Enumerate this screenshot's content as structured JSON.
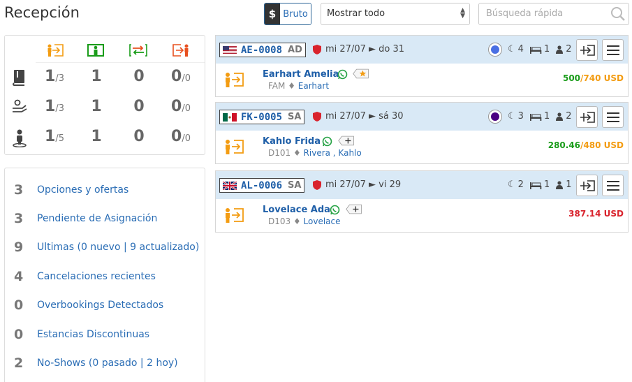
{
  "header": {
    "title": "Recepción",
    "currency_symbol": "$",
    "gross_label": "Bruto",
    "filter_value": "Mostrar todo",
    "search_placeholder": "Búsqueda rápida"
  },
  "summary": {
    "columns": [
      "arrivals-icon",
      "in-house-icon",
      "room-moves-icon",
      "departures-icon"
    ],
    "column_colors": [
      "#f39c12",
      "#1a9c1a",
      "#1a9c1a",
      "#e8501f"
    ],
    "rows": [
      {
        "icon": "book-icon",
        "arrivals": "1",
        "arrivals_total": "/3",
        "in_house": "1",
        "moves": "0",
        "departures": "0",
        "departures_total": "/0"
      },
      {
        "icon": "service-icon",
        "arrivals": "1",
        "arrivals_total": "/3",
        "in_house": "1",
        "moves": "0",
        "departures": "0",
        "departures_total": "/0"
      },
      {
        "icon": "person-icon",
        "arrivals": "1",
        "arrivals_total": "/5",
        "in_house": "1",
        "moves": "0",
        "departures": "0",
        "departures_total": "/0"
      }
    ]
  },
  "lists": [
    {
      "count": "3",
      "label": "Opciones y ofertas"
    },
    {
      "count": "3",
      "label": "Pendiente de Asignación"
    },
    {
      "count": "9",
      "label": "Ultimas (0 nuevo | 9 actualizado)"
    },
    {
      "count": "4",
      "label": "Cancelaciones recientes"
    },
    {
      "count": "0",
      "label": "Overbookings Detectados"
    },
    {
      "count": "0",
      "label": "Estancias Discontinuas"
    },
    {
      "count": "2",
      "label": "No-Shows (0 pasado | 2 hoy)"
    }
  ],
  "reservations": [
    {
      "flag": "us-flag-icon",
      "code": "AE-0008",
      "type": "AD",
      "dates": "mi 27/07 ► do 31",
      "status_color": "#4a6fe3",
      "nights": "4",
      "rooms": "1",
      "guests": "2",
      "guest_name": "Earhart Amelia",
      "room": "FAM",
      "sub_name": "Earhart",
      "tag": "star-tag-icon",
      "paid": "500",
      "total": "/740 USD",
      "paid_color": "#1a9c1a",
      "total_color": "#f39c12"
    },
    {
      "flag": "mx-flag-icon",
      "code": "FK-0005",
      "type": "SA",
      "dates": "mi 27/07 ► sá 30",
      "status_color": "#4b0082",
      "nights": "3",
      "rooms": "1",
      "guests": "2",
      "guest_name": "Kahlo Frida",
      "room": "D101",
      "sub_name": "Rivera , Kahlo",
      "tag": "plus-tag-icon",
      "paid": "280.46",
      "total": "/480 USD",
      "paid_color": "#1a9c1a",
      "total_color": "#f39c12"
    },
    {
      "flag": "uk-flag-icon",
      "code": "AL-0006",
      "type": "SA",
      "dates": "mi 27/07 ► vi 29",
      "status_color": "",
      "nights": "2",
      "rooms": "1",
      "guests": "1",
      "guest_name": "Lovelace Ada",
      "room": "D103",
      "sub_name": "Lovelace",
      "tag": "plus-tag-icon",
      "paid": "387.14 USD",
      "total": "",
      "paid_color": "#d9232d",
      "total_color": "#d9232d"
    }
  ]
}
